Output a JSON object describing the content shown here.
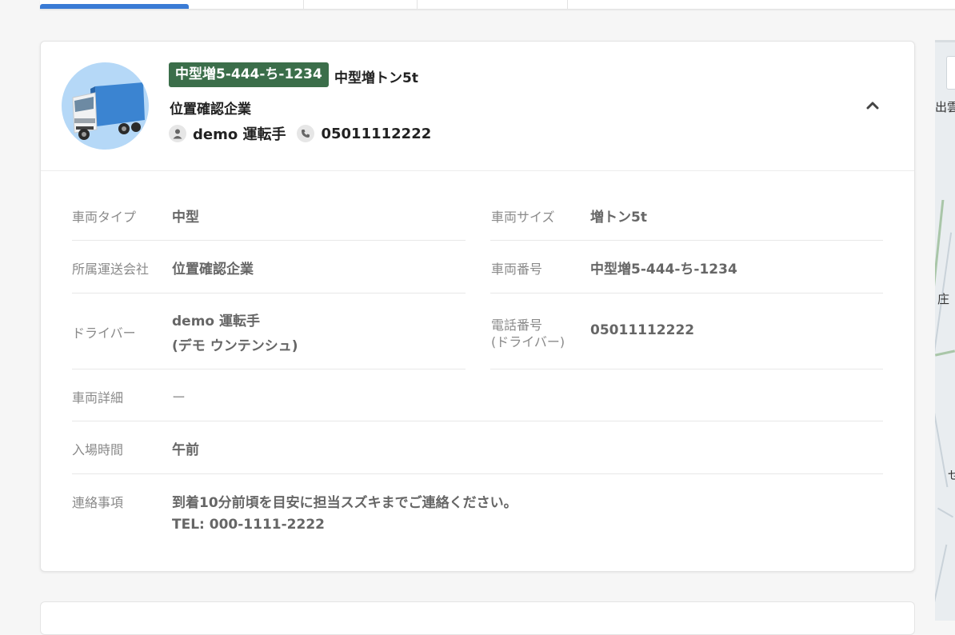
{
  "header": {
    "plate": "中型増5-444-ち-1234",
    "vehicle_type": "中型増トン5t",
    "company": "位置確認企業",
    "driver_name": "demo 運転手",
    "phone": "05011112222"
  },
  "details": {
    "vehicle_type_label": "車両タイプ",
    "vehicle_type_value": "中型",
    "vehicle_size_label": "車両サイズ",
    "vehicle_size_value": "増トン5t",
    "carrier_label": "所属運送会社",
    "carrier_value": "位置確認企業",
    "vehicle_number_label": "車両番号",
    "vehicle_number_value": "中型増5-444-ち-1234",
    "driver_label": "ドライバー",
    "driver_value_line1": "demo 運転手",
    "driver_value_line2": "(デモ ウンテンシュ)",
    "phone_label_line1": "電話番号",
    "phone_label_line2": "(ドライバー)",
    "phone_value": "05011112222",
    "vehicle_detail_label": "車両詳細",
    "vehicle_detail_value": "ー",
    "entry_time_label": "入場時間",
    "entry_time_value": "午前",
    "notes_label": "連絡事項",
    "notes_line1": "到着10分前頃を目安に担当スズキまでご連絡ください。",
    "notes_line2": "TEL: 000-1111-2222"
  },
  "map": {
    "labels": [
      "出雲",
      "庄",
      "せ"
    ]
  },
  "colors": {
    "accent": "#3a7bd5",
    "plate_bg": "#3b6e4a",
    "avatar_bg": "#b5d8f7"
  }
}
